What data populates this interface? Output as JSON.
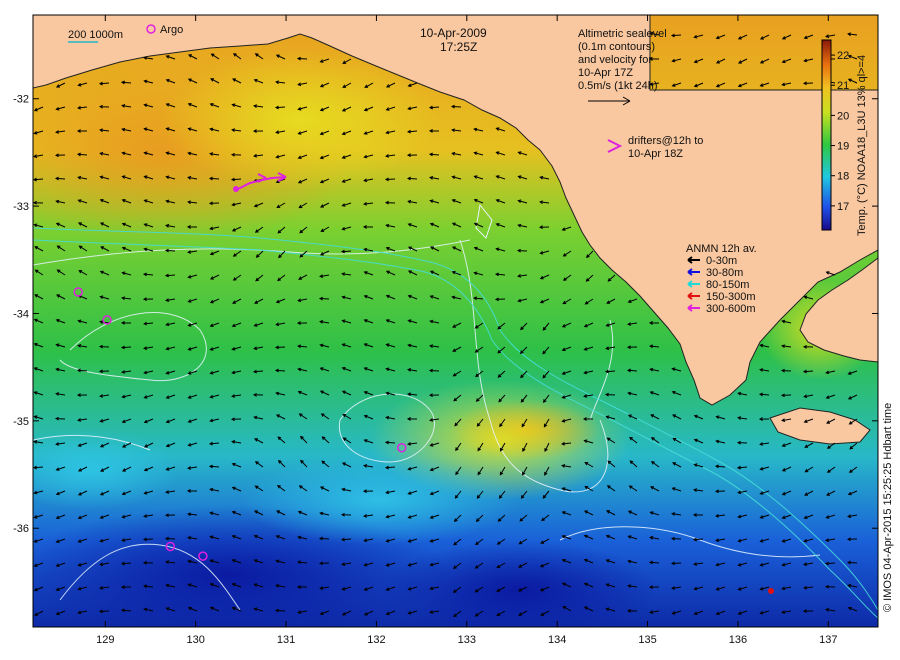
{
  "title": {
    "date": "10-Apr-2009",
    "time": "17:25Z"
  },
  "scale_bar": {
    "label": "200  1000m",
    "color": "#22b7c8"
  },
  "argo": {
    "label": "Argo",
    "marker_color": "#e020e0",
    "floats": [
      {
        "lon": 128.7,
        "lat": -33.8
      },
      {
        "lon": 129.02,
        "lat": -34.06
      },
      {
        "lon": 132.28,
        "lat": -35.25
      },
      {
        "lon": 129.72,
        "lat": -36.17
      },
      {
        "lon": 130.08,
        "lat": -36.26
      }
    ]
  },
  "altimetry_note": [
    "Altimetric sealevel",
    "(0.1m contours)",
    "and velocity for",
    "10-Apr 17Z",
    "0.5m/s (1kt 24h)"
  ],
  "drifters_note": [
    "drifters@12h to",
    "10-Apr 18Z"
  ],
  "anmn": {
    "title": "ANMN 12h av.",
    "items": [
      {
        "label": "0-30m",
        "color": "#000000"
      },
      {
        "label": "30-80m",
        "color": "#1010e0"
      },
      {
        "label": "80-150m",
        "color": "#20d8d8"
      },
      {
        "label": "150-300m",
        "color": "#e01010"
      },
      {
        "label": "300-600m",
        "color": "#e020e0"
      }
    ]
  },
  "colorbar": {
    "label": "Temp. (°C) NOAA18_L3U 13% ql>=4",
    "ticks": [
      "17",
      "18",
      "19",
      "20",
      "21",
      "22"
    ],
    "min": 16.2,
    "max": 22.5
  },
  "credit": "© IMOS 04-Apr-2015 15:25:25 Hdbart time",
  "axes": {
    "lon_ticks": [
      "129",
      "130",
      "131",
      "132",
      "133",
      "134",
      "135",
      "136",
      "137"
    ],
    "lat_ticks": [
      "-32",
      "-33",
      "-34",
      "-35",
      "-36"
    ],
    "lon_range": [
      128.2,
      137.55
    ],
    "lat_range": [
      -36.92,
      -31.22
    ]
  },
  "colors": {
    "land": "#f9c8a0",
    "ocean_cool": "#1430c8",
    "ocean_mid": "#2fc440",
    "ocean_warm": "#f2a41c",
    "contour": "#e8f4ff",
    "isobath": "#46dcd8"
  }
}
